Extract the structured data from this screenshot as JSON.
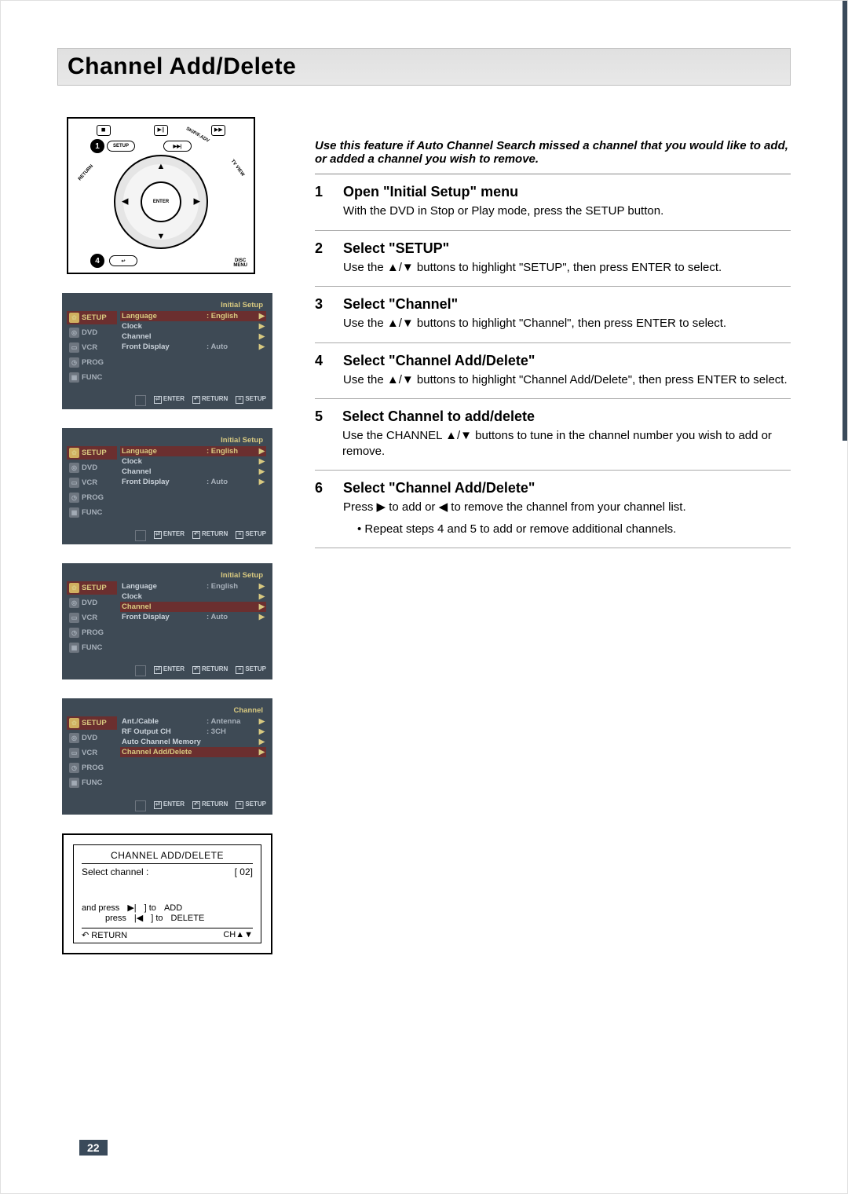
{
  "page_title": "Channel Add/Delete",
  "page_number": "22",
  "intro": "Use this feature if Auto Channel Search missed a channel that you would like to add, or added a channel you wish to remove.",
  "remote": {
    "setup": "SETUP",
    "skip": "SKIP/F.ADV",
    "return": "RETURN",
    "tvview": "TV VIEW",
    "enter": "ENTER",
    "disc": "DISC",
    "menu": "MENU",
    "num1": "1",
    "num4": "4"
  },
  "osd": {
    "title_setup": "Initial Setup",
    "title_channel": "Channel",
    "side_tabs": [
      "SETUP",
      "DVD",
      "VCR",
      "PROG",
      "FUNC"
    ],
    "setup_rows": [
      {
        "label": "Language",
        "val": ": English"
      },
      {
        "label": "Clock",
        "val": ""
      },
      {
        "label": "Channel",
        "val": ""
      },
      {
        "label": "Front Display",
        "val": ": Auto"
      }
    ],
    "channel_rows": [
      {
        "label": "Ant./Cable",
        "val": ": Antenna"
      },
      {
        "label": "RF Output CH",
        "val": ": 3CH"
      },
      {
        "label": "Auto Channel Memory",
        "val": ""
      },
      {
        "label": "Channel Add/Delete",
        "val": ""
      }
    ],
    "footer": {
      "enter": "ENTER",
      "return": "RETURN",
      "setup": "SETUP"
    }
  },
  "setup_sel": [
    0,
    0,
    2,
    3
  ],
  "cad": {
    "title": "CHANNEL ADD/DELETE",
    "select": "Select channel :",
    "value": "[ 02]",
    "and_press": "and  press",
    "press": "press",
    "to": "] to",
    "add": "ADD",
    "del": "DELETE",
    "return": "RETURN",
    "ch": "CH▲▼"
  },
  "steps": [
    {
      "num": "1",
      "title": "Open \"Initial Setup\" menu",
      "body": "With the DVD in Stop or Play mode, press the SETUP button."
    },
    {
      "num": "2",
      "title": "Select \"SETUP\"",
      "body": "Use the ▲/▼ buttons to highlight \"SETUP\", then press ENTER to select."
    },
    {
      "num": "3",
      "title": "Select \"Channel\"",
      "body": "Use the ▲/▼ buttons to highlight \"Channel\", then press ENTER to select."
    },
    {
      "num": "4",
      "title": "Select \"Channel Add/Delete\"",
      "body": "Use the ▲/▼ buttons to highlight \"Channel Add/Delete\", then press ENTER to select."
    },
    {
      "num": "5",
      "title": "Select Channel to add/delete",
      "body": "Use the CHANNEL ▲/▼ buttons to tune in the channel number you wish to add or remove."
    },
    {
      "num": "6",
      "title": "Select \"Channel Add/Delete\"",
      "body": "Press ▶ to add or ◀ to remove the channel from your channel list.",
      "bullet": "Repeat steps 4 and 5 to add or remove additional channels."
    }
  ]
}
